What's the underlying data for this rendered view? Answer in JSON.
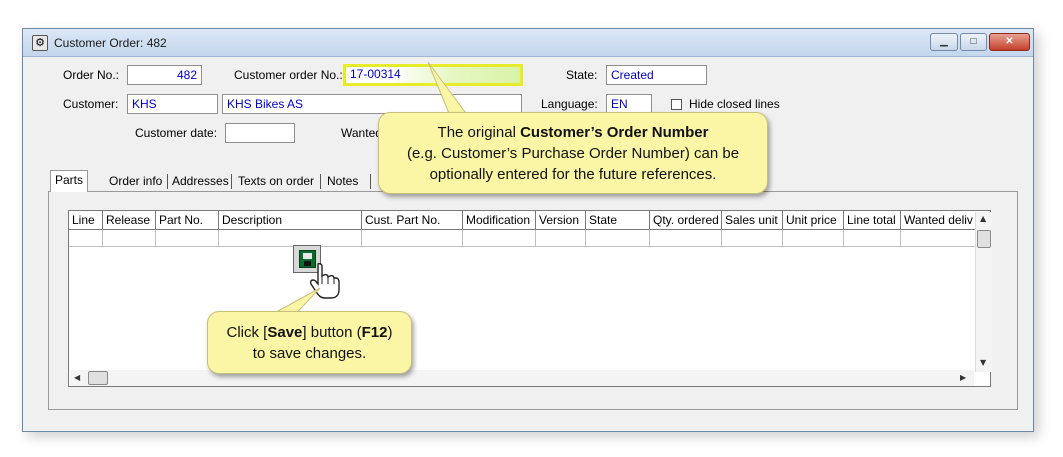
{
  "window": {
    "title": "Customer Order: 482"
  },
  "header": {
    "order_no_label": "Order No.:",
    "order_no": "482",
    "customer_order_no_label": "Customer order No.:",
    "customer_order_no": "17-00314",
    "state_label": "State:",
    "state": "Created",
    "customer_label": "Customer:",
    "customer_code": "KHS",
    "customer_name": "KHS Bikes AS",
    "language_label": "Language:",
    "language": "EN",
    "hide_closed_lines_label": "Hide closed lines",
    "customer_date_label": "Customer date:",
    "customer_date": "",
    "wanted_label": "Wanted"
  },
  "tabs": [
    {
      "label": "Parts"
    },
    {
      "label": "Order info"
    },
    {
      "label": "Addresses"
    },
    {
      "label": "Texts on order"
    },
    {
      "label": "Notes"
    }
  ],
  "grid": {
    "columns": [
      "Line",
      "Release",
      "Part No.",
      "Description",
      "Cust. Part No.",
      "Modification",
      "Version",
      "State",
      "Qty. ordered",
      "Sales unit",
      "Unit price",
      "Line total",
      "Wanted deliv"
    ]
  },
  "callouts": {
    "top": {
      "line1_pre": "The original ",
      "line1_bold": "Customer’s Order Number",
      "line2": "(e.g. Customer’s Purchase Order Number) can be",
      "line3": "optionally entered for the future references."
    },
    "bottom": {
      "line1_pre": "Click [",
      "line1_bold1": "Save",
      "line1_mid": "] button (",
      "line1_bold2": "F12",
      "line1_post": ")",
      "line2": "to save changes."
    }
  },
  "icons": {
    "title": "app-gear-icon",
    "save": "floppy-disk-icon",
    "cursor": "hand-pointer-icon"
  },
  "colors": {
    "field_text": "#0000cc",
    "highlight": "#e6ec2a",
    "callout_bg": "#fbf6a6"
  }
}
